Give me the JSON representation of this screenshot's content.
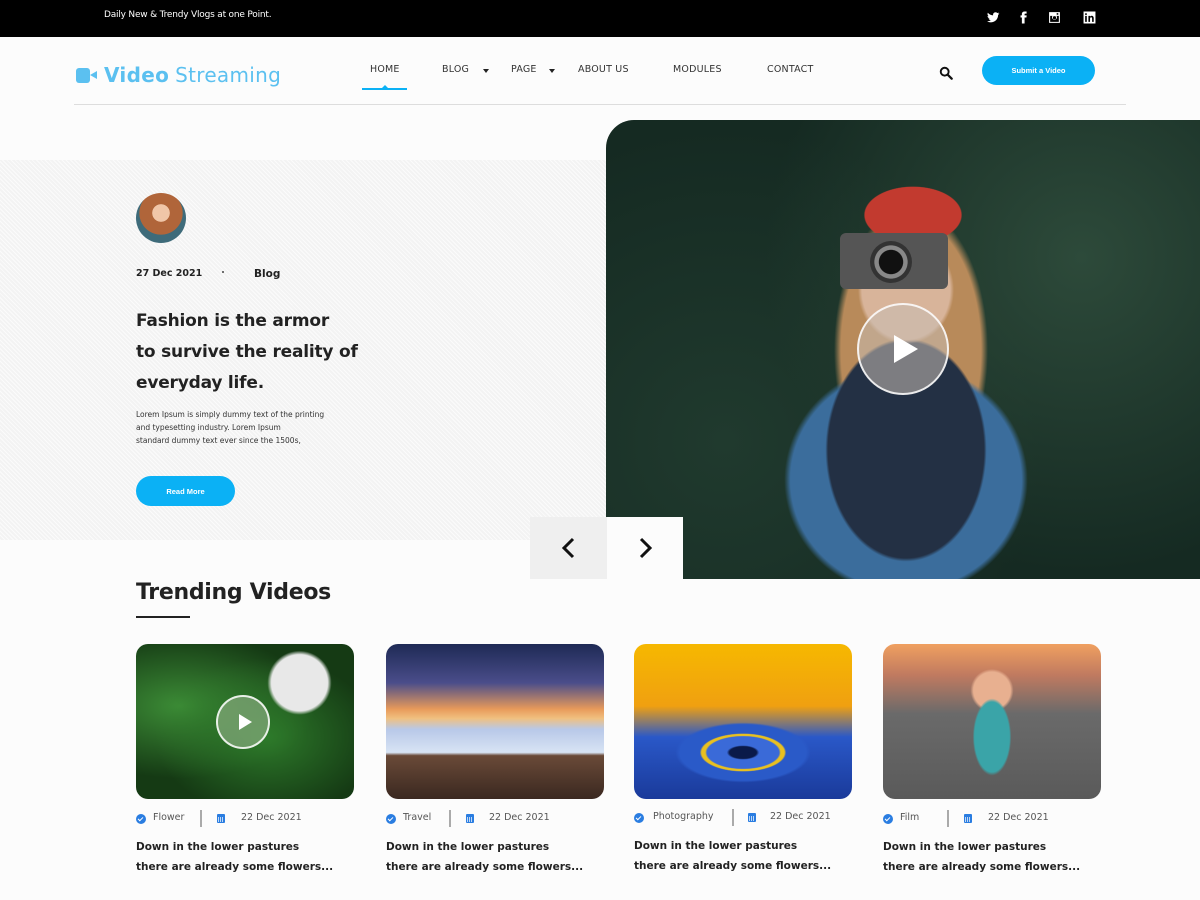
{
  "topbar": {
    "tagline": "Daily New & Trendy Vlogs at one Point.",
    "social": [
      {
        "icon": "twitter-icon"
      },
      {
        "icon": "facebook-icon"
      },
      {
        "icon": "instagram-icon"
      },
      {
        "icon": "linkedin-icon"
      }
    ]
  },
  "header": {
    "logo_bold": "Video",
    "logo_light": "Streaming",
    "nav": [
      {
        "label": "HOME",
        "active": true
      },
      {
        "label": "BLOG",
        "dropdown": true
      },
      {
        "label": "PAGE",
        "dropdown": true
      },
      {
        "label": "ABOUT US"
      },
      {
        "label": "MODULES"
      },
      {
        "label": "CONTACT"
      }
    ],
    "submit_label": "Submit a Video"
  },
  "hero": {
    "date": "27 Dec 2021",
    "category": "Blog",
    "title_lines": [
      "Fashion is the armor",
      "to survive the reality of",
      "everyday life."
    ],
    "description_lines": [
      "Lorem Ipsum is simply dummy text of the printing",
      "and typesetting industry. Lorem Ipsum",
      "standard dummy text ever since the 1500s,"
    ],
    "read_more": "Read More"
  },
  "trending": {
    "title": "Trending Videos",
    "cards": [
      {
        "category": "Flower",
        "date": "22 Dec 2021",
        "title_lines": [
          "Down in the lower pastures",
          "there are already some flowers..."
        ],
        "has_play": true
      },
      {
        "category": "Travel",
        "date": "22 Dec 2021",
        "title_lines": [
          "Down in the lower pastures",
          "there are already some flowers..."
        ]
      },
      {
        "category": "Photography",
        "date": "22 Dec 2021",
        "title_lines": [
          "Down in the lower pastures",
          "there are already some flowers..."
        ]
      },
      {
        "category": "Film",
        "date": "22 Dec 2021",
        "title_lines": [
          "Down in the lower pastures",
          "there are already some flowers..."
        ]
      }
    ]
  },
  "colors": {
    "accent": "#0bb1f5",
    "logo": "#5bc0f0",
    "meta_icon": "#2a7de1"
  }
}
